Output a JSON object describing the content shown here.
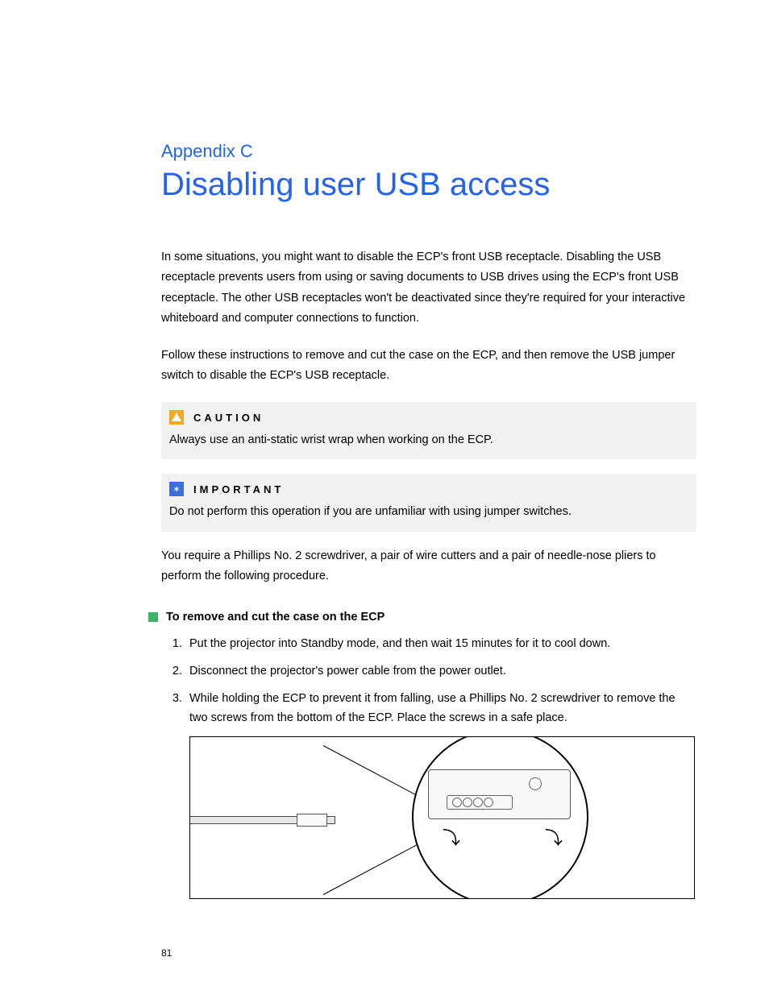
{
  "appendix_label": "Appendix  C",
  "title": "Disabling user USB access",
  "paragraphs": {
    "p1": "In some situations, you might want to disable the ECP's front USB receptacle. Disabling the USB receptacle prevents users from using or saving documents to USB drives using the ECP's front USB receptacle. The other USB receptacles won't be deactivated since they're required for your interactive whiteboard and computer connections to function.",
    "p2": "Follow these instructions to remove and cut the case on the ECP, and then remove the USB jumper switch to disable the ECP's USB receptacle.",
    "p3": "You require a Phillips No. 2 screwdriver, a pair of wire cutters and a pair of needle-nose pliers to perform the following procedure."
  },
  "callout_caution": {
    "label": "CAUTION",
    "text": "Always use an anti-static wrist wrap when working on the ECP."
  },
  "callout_important": {
    "label": "IMPORTANT",
    "text": "Do not perform this operation if you are unfamiliar with using jumper switches."
  },
  "procedure": {
    "title": "To remove and cut the case on the ECP",
    "steps": [
      "Put the projector into Standby mode, and then wait 15 minutes for it to cool down.",
      "Disconnect the projector's power cable from the power outlet.",
      "While holding the ECP to prevent it from falling, use a Phillips No. 2 screwdriver to remove the two screws from the bottom of the ECP. Place the screws in a safe place."
    ]
  },
  "page_number": "81"
}
